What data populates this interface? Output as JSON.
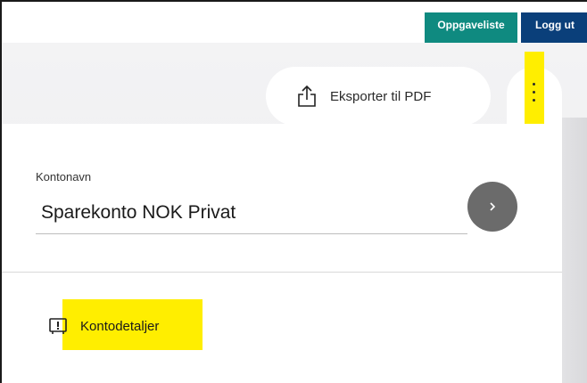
{
  "header": {
    "tasks_label": "Oppgaveliste",
    "logout_label": "Logg ut",
    "tasks_color": "#0f8a80",
    "logout_color": "#0a3f7a"
  },
  "toolbar": {
    "export_label": "Eksporter til PDF",
    "export_icon": "share-upload-icon",
    "more_icon": "more-vertical-icon"
  },
  "account": {
    "name_label": "Kontonavn",
    "name_value": "Sparekonto NOK Privat",
    "go_icon": "chevron-right-icon"
  },
  "details": {
    "label": "Kontodetaljer",
    "icon": "account-info-icon"
  },
  "highlight_color": "#ffee00"
}
